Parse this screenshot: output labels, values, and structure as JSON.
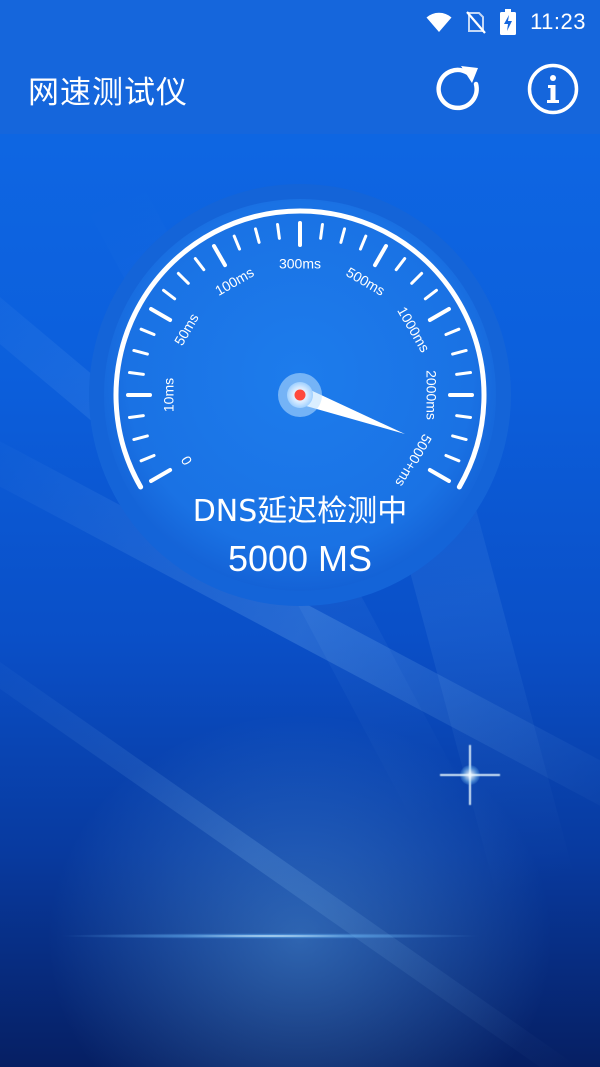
{
  "status_bar": {
    "time": "11:23",
    "icons": [
      "wifi-icon",
      "no-sim-icon",
      "battery-charging-icon"
    ]
  },
  "app_bar": {
    "title": "网速测试仪",
    "actions": [
      {
        "icon": "refresh-icon"
      },
      {
        "icon": "info-icon"
      }
    ]
  },
  "gauge": {
    "ticks": [
      {
        "label": "0"
      },
      {
        "label": "10ms"
      },
      {
        "label": "50ms"
      },
      {
        "label": "100ms"
      },
      {
        "label": "300ms"
      },
      {
        "label": "500ms"
      },
      {
        "label": "1000ms"
      },
      {
        "label": "2000ms"
      },
      {
        "label": "5000+ms"
      }
    ],
    "needle_fraction": 0.96,
    "status_text": "DNS延迟检测中",
    "value_text": "5000 MS",
    "colors": {
      "dial": "#1a74e6",
      "dial_ring": "#1464d8",
      "arc": "#ffffff",
      "hub_dot": "#ff4a3d"
    }
  },
  "colors": {
    "app_bar": "#1566dc",
    "background_top": "#0f6ae6",
    "background_bottom": "#061f63"
  }
}
